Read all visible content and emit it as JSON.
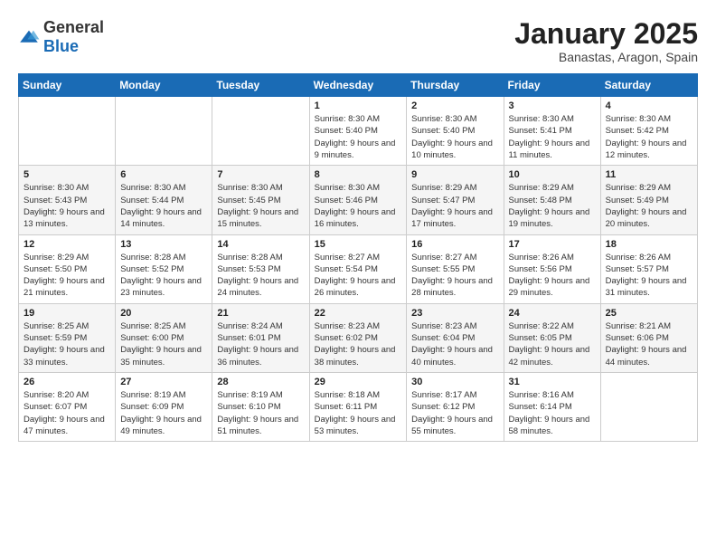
{
  "logo": {
    "general": "General",
    "blue": "Blue"
  },
  "title": "January 2025",
  "subtitle": "Banastas, Aragon, Spain",
  "days_of_week": [
    "Sunday",
    "Monday",
    "Tuesday",
    "Wednesday",
    "Thursday",
    "Friday",
    "Saturday"
  ],
  "weeks": [
    [
      {
        "day": "",
        "info": ""
      },
      {
        "day": "",
        "info": ""
      },
      {
        "day": "",
        "info": ""
      },
      {
        "day": "1",
        "info": "Sunrise: 8:30 AM\nSunset: 5:40 PM\nDaylight: 9 hours and 9 minutes."
      },
      {
        "day": "2",
        "info": "Sunrise: 8:30 AM\nSunset: 5:40 PM\nDaylight: 9 hours and 10 minutes."
      },
      {
        "day": "3",
        "info": "Sunrise: 8:30 AM\nSunset: 5:41 PM\nDaylight: 9 hours and 11 minutes."
      },
      {
        "day": "4",
        "info": "Sunrise: 8:30 AM\nSunset: 5:42 PM\nDaylight: 9 hours and 12 minutes."
      }
    ],
    [
      {
        "day": "5",
        "info": "Sunrise: 8:30 AM\nSunset: 5:43 PM\nDaylight: 9 hours and 13 minutes."
      },
      {
        "day": "6",
        "info": "Sunrise: 8:30 AM\nSunset: 5:44 PM\nDaylight: 9 hours and 14 minutes."
      },
      {
        "day": "7",
        "info": "Sunrise: 8:30 AM\nSunset: 5:45 PM\nDaylight: 9 hours and 15 minutes."
      },
      {
        "day": "8",
        "info": "Sunrise: 8:30 AM\nSunset: 5:46 PM\nDaylight: 9 hours and 16 minutes."
      },
      {
        "day": "9",
        "info": "Sunrise: 8:29 AM\nSunset: 5:47 PM\nDaylight: 9 hours and 17 minutes."
      },
      {
        "day": "10",
        "info": "Sunrise: 8:29 AM\nSunset: 5:48 PM\nDaylight: 9 hours and 19 minutes."
      },
      {
        "day": "11",
        "info": "Sunrise: 8:29 AM\nSunset: 5:49 PM\nDaylight: 9 hours and 20 minutes."
      }
    ],
    [
      {
        "day": "12",
        "info": "Sunrise: 8:29 AM\nSunset: 5:50 PM\nDaylight: 9 hours and 21 minutes."
      },
      {
        "day": "13",
        "info": "Sunrise: 8:28 AM\nSunset: 5:52 PM\nDaylight: 9 hours and 23 minutes."
      },
      {
        "day": "14",
        "info": "Sunrise: 8:28 AM\nSunset: 5:53 PM\nDaylight: 9 hours and 24 minutes."
      },
      {
        "day": "15",
        "info": "Sunrise: 8:27 AM\nSunset: 5:54 PM\nDaylight: 9 hours and 26 minutes."
      },
      {
        "day": "16",
        "info": "Sunrise: 8:27 AM\nSunset: 5:55 PM\nDaylight: 9 hours and 28 minutes."
      },
      {
        "day": "17",
        "info": "Sunrise: 8:26 AM\nSunset: 5:56 PM\nDaylight: 9 hours and 29 minutes."
      },
      {
        "day": "18",
        "info": "Sunrise: 8:26 AM\nSunset: 5:57 PM\nDaylight: 9 hours and 31 minutes."
      }
    ],
    [
      {
        "day": "19",
        "info": "Sunrise: 8:25 AM\nSunset: 5:59 PM\nDaylight: 9 hours and 33 minutes."
      },
      {
        "day": "20",
        "info": "Sunrise: 8:25 AM\nSunset: 6:00 PM\nDaylight: 9 hours and 35 minutes."
      },
      {
        "day": "21",
        "info": "Sunrise: 8:24 AM\nSunset: 6:01 PM\nDaylight: 9 hours and 36 minutes."
      },
      {
        "day": "22",
        "info": "Sunrise: 8:23 AM\nSunset: 6:02 PM\nDaylight: 9 hours and 38 minutes."
      },
      {
        "day": "23",
        "info": "Sunrise: 8:23 AM\nSunset: 6:04 PM\nDaylight: 9 hours and 40 minutes."
      },
      {
        "day": "24",
        "info": "Sunrise: 8:22 AM\nSunset: 6:05 PM\nDaylight: 9 hours and 42 minutes."
      },
      {
        "day": "25",
        "info": "Sunrise: 8:21 AM\nSunset: 6:06 PM\nDaylight: 9 hours and 44 minutes."
      }
    ],
    [
      {
        "day": "26",
        "info": "Sunrise: 8:20 AM\nSunset: 6:07 PM\nDaylight: 9 hours and 47 minutes."
      },
      {
        "day": "27",
        "info": "Sunrise: 8:19 AM\nSunset: 6:09 PM\nDaylight: 9 hours and 49 minutes."
      },
      {
        "day": "28",
        "info": "Sunrise: 8:19 AM\nSunset: 6:10 PM\nDaylight: 9 hours and 51 minutes."
      },
      {
        "day": "29",
        "info": "Sunrise: 8:18 AM\nSunset: 6:11 PM\nDaylight: 9 hours and 53 minutes."
      },
      {
        "day": "30",
        "info": "Sunrise: 8:17 AM\nSunset: 6:12 PM\nDaylight: 9 hours and 55 minutes."
      },
      {
        "day": "31",
        "info": "Sunrise: 8:16 AM\nSunset: 6:14 PM\nDaylight: 9 hours and 58 minutes."
      },
      {
        "day": "",
        "info": ""
      }
    ]
  ]
}
